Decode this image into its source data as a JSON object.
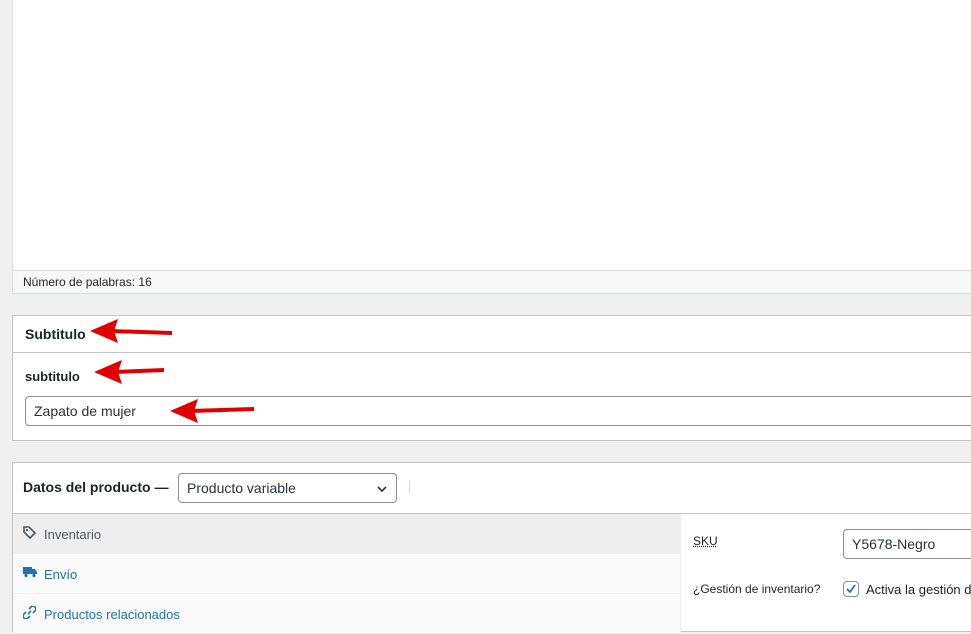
{
  "editor": {
    "word_count_label": "Número de palabras: 16"
  },
  "subtitle_box": {
    "title": "Subtitulo",
    "field_label": "subtitulo",
    "field_value": "Zapato de mujer"
  },
  "product_data": {
    "title": "Datos del producto —",
    "type_select": {
      "selected": "Producto variable"
    },
    "tabs": [
      {
        "label": "Inventario",
        "icon": "tag-icon",
        "active": true
      },
      {
        "label": "Envío",
        "icon": "truck-icon",
        "active": false
      },
      {
        "label": "Productos relacionados",
        "icon": "link-icon",
        "active": false
      }
    ],
    "inventory": {
      "sku_label": "SKU",
      "sku_value": "Y5678-Negro",
      "manage_stock_label": "¿Gestión de inventario?",
      "manage_stock_checkbox_label": "Activa la gestión d",
      "manage_stock_checked": true
    }
  },
  "annotation_color": "#e00000",
  "link_color": "#2271b1"
}
